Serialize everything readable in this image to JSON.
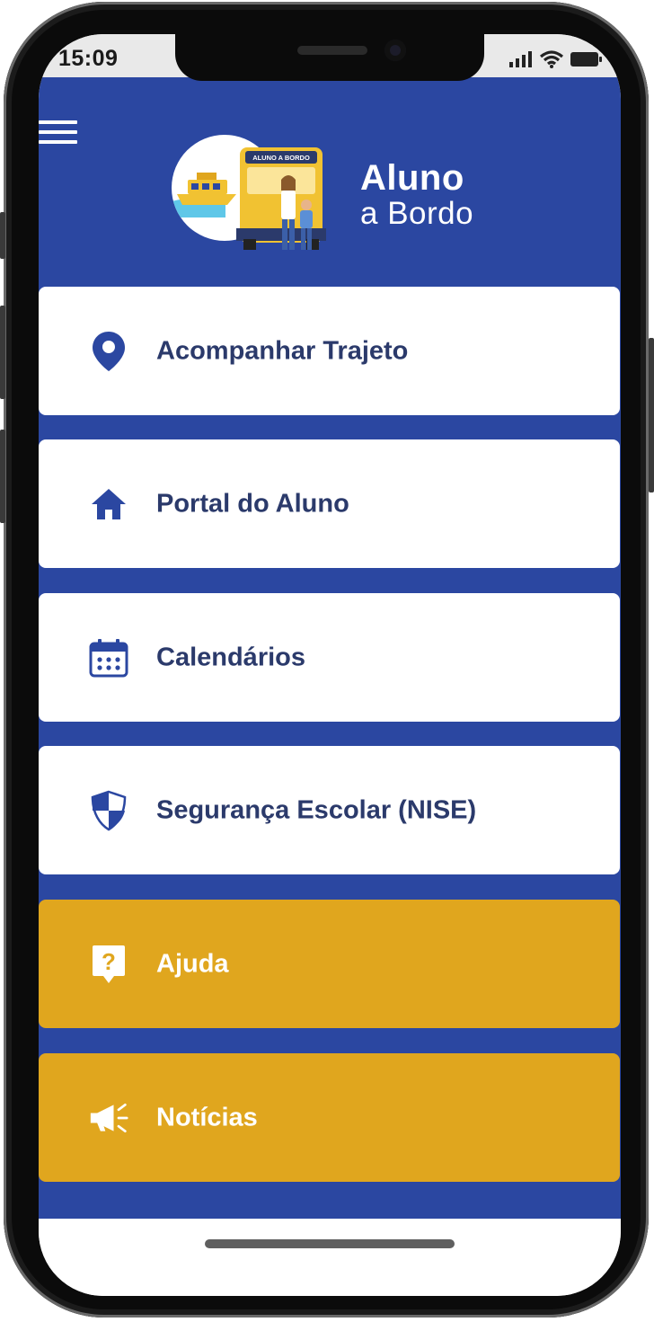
{
  "status_bar": {
    "time": "15:09",
    "icons": [
      "signal-icon",
      "wifi-icon",
      "battery-icon"
    ]
  },
  "header": {
    "menu_icon": "hamburger-menu-icon",
    "logo": {
      "line1": "Aluno",
      "line2": "a Bordo",
      "bus_sign": "ALUNO A BORDO"
    }
  },
  "menu": {
    "items": [
      {
        "label": "Acompanhar Trajeto",
        "icon": "location-pin-icon",
        "style": "white"
      },
      {
        "label": "Portal do Aluno",
        "icon": "home-icon",
        "style": "white"
      },
      {
        "label": "Calendários",
        "icon": "calendar-icon",
        "style": "white"
      },
      {
        "label": "Segurança Escolar (NISE)",
        "icon": "shield-icon",
        "style": "white"
      },
      {
        "label": "Ajuda",
        "icon": "help-question-icon",
        "style": "gold"
      },
      {
        "label": "Notícias",
        "icon": "megaphone-icon",
        "style": "gold"
      }
    ]
  },
  "colors": {
    "primary_blue": "#2b47a1",
    "card_white": "#ffffff",
    "accent_gold": "#e0a61e",
    "label_dark": "#2b3a6b"
  }
}
